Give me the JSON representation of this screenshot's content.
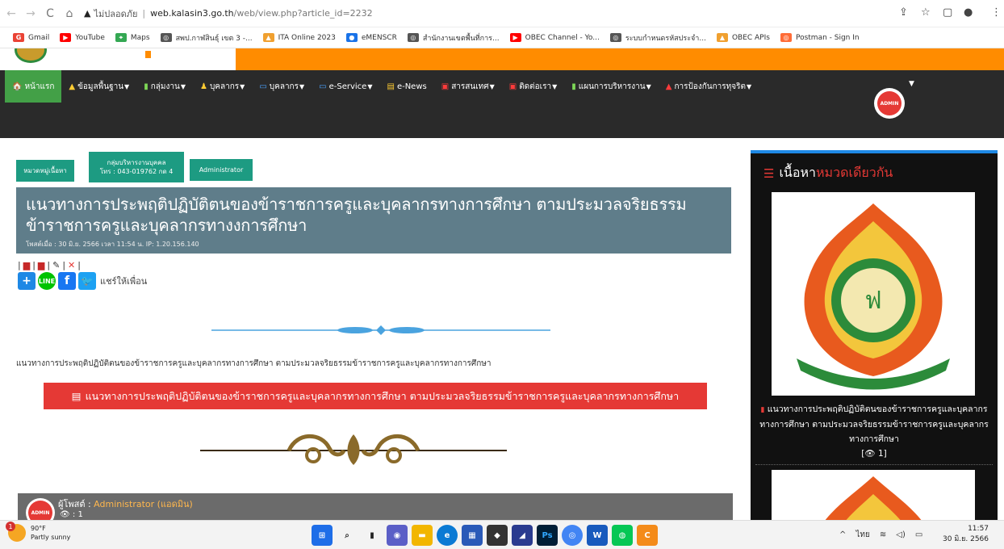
{
  "browser": {
    "security_label": "ไม่ปลอดภัย",
    "url_host": "web.kalasin3.go.th",
    "url_path": "/web/view.php?article_id=2232"
  },
  "bookmarks": [
    {
      "label": "Gmail",
      "color": "#ea4335",
      "glyph": "G"
    },
    {
      "label": "YouTube",
      "color": "#ff0000",
      "glyph": "▶"
    },
    {
      "label": "Maps",
      "color": "#34a853",
      "glyph": "⌖"
    },
    {
      "label": "สพป.กาฬสินธุ์ เขต 3 -...",
      "color": "#555555",
      "glyph": "◎"
    },
    {
      "label": "ITA Online 2023",
      "color": "#f0a030",
      "glyph": "▲"
    },
    {
      "label": "eMENSCR",
      "color": "#1a73e8",
      "glyph": "●"
    },
    {
      "label": "สำนักงานเขตพื้นที่การ...",
      "color": "#555555",
      "glyph": "◎"
    },
    {
      "label": "OBEC Channel - Yo...",
      "color": "#ff0000",
      "glyph": "▶"
    },
    {
      "label": "ระบบกำหนดรหัสประจำ...",
      "color": "#555555",
      "glyph": "◎"
    },
    {
      "label": "OBEC APIs",
      "color": "#f0a030",
      "glyph": "▲"
    },
    {
      "label": "Postman - Sign In",
      "color": "#ff6c37",
      "glyph": "◎"
    }
  ],
  "nav": [
    {
      "icon": "home-icon",
      "glyph": "🏠",
      "label": "หน้าแรก",
      "active": true,
      "dropdown": false
    },
    {
      "icon": "info-icon",
      "glyph": "▲",
      "label": "ข้อมูลพื้นฐาน",
      "active": false,
      "dropdown": true
    },
    {
      "icon": "folder-icon",
      "glyph": "▮",
      "label": "กลุ่มงาน",
      "active": false,
      "dropdown": true
    },
    {
      "icon": "user-icon",
      "glyph": "♟",
      "label": "บุคลากร",
      "active": false,
      "dropdown": true
    },
    {
      "icon": "window-icon",
      "glyph": "▭",
      "label": "บุคลากร",
      "active": false,
      "dropdown": true
    },
    {
      "icon": "window-icon",
      "glyph": "▭",
      "label": "e-Service",
      "active": false,
      "dropdown": true
    },
    {
      "icon": "news-icon",
      "glyph": "▤",
      "label": "e-News",
      "active": false,
      "dropdown": false
    },
    {
      "icon": "bus-icon",
      "glyph": "▣",
      "label": "สารสนเทศ",
      "active": false,
      "dropdown": true
    },
    {
      "icon": "bus-icon",
      "glyph": "▣",
      "label": "ติดต่อเรา",
      "active": false,
      "dropdown": true
    },
    {
      "icon": "file-icon",
      "glyph": "▮",
      "label": "แผนการบริหารงาน",
      "active": false,
      "dropdown": true
    },
    {
      "icon": "bell-icon",
      "glyph": "▲",
      "label": "การป้องกันการทุจริต",
      "active": false,
      "dropdown": true
    }
  ],
  "avatar_text": "ADMIN",
  "tags": {
    "category": "หมวดหมู่เนื้อหา",
    "group_line1": "กลุ่มบริหารงานบุคคล",
    "group_line2": "โทร : 043-019762 กด 4",
    "admin": "Administrator"
  },
  "article": {
    "title": "แนวทางการประพฤติปฏิบัติตนของข้าราชการครูและบุคลากรทางการศึกษา ตามประมวลจริยธรรมข้าราชการครูและบุคลากรทางงการศึกษา",
    "meta": "โพสต์เมื่อ : 30 มิ.ย. 2566 เวลา 11:54 น. IP: 1.20.156.140",
    "share_text": "แชร์ให้เพื่อน",
    "body": "แนวทางการประพฤติปฏิบัติตนของข้าราชการครูและบุคลากรทางการศึกษา ตามประมวลจริยธรรมข้าราชการครูและบุคลากรทางการศึกษา",
    "pdf_button": "แนวทางการประพฤติปฏิบัติตนของข้าราชการครูและบุคลากรทางการศึกษา ตามประมวลจริยธรรมข้าราชการครูและบุคลากรทางการศึกษา"
  },
  "author": {
    "label": "ผู้โพสต์ :",
    "name": "Administrator (แอดมิน)",
    "views": ": 1"
  },
  "sidebar": {
    "heading_white": "เนื้อหา",
    "heading_red": "หมวดเดียวกัน",
    "caption": "แนวทางการประพฤติปฏิบัติตนของข้าราชการครูและบุคลากรทางการศึกษา ตามประมวลจริยธรรมข้าราชการครูและบุคลากรทางการศึกษา",
    "views": "[👁 1]"
  },
  "taskbar": {
    "temp": "90°F",
    "weather": "Partly sunny",
    "badge": "1",
    "lang": "ไทย",
    "time": "11:57",
    "date": "30 มิ.ย. 2566"
  }
}
